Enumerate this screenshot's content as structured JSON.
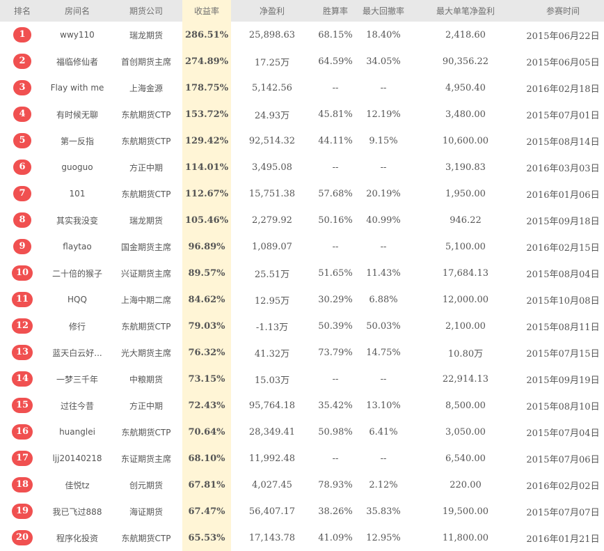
{
  "headers": {
    "rank": "排名",
    "room": "房间名",
    "company": "期货公司",
    "rate": "收益率",
    "net": "净盈利",
    "win": "胜算率",
    "drawdown": "最大回撤率",
    "max_single": "最大单笔净盈利",
    "date": "参赛时间"
  },
  "colors": {
    "badge": "#f05050",
    "highlight_column": "#fff5d6",
    "header_bg": "#e8e8e8"
  },
  "rows": [
    {
      "rank": "1",
      "room": "wwy110",
      "company": "瑞龙期货",
      "rate": "286.51%",
      "net": "25,898.63",
      "win": "68.15%",
      "drawdown": "18.40%",
      "max_single": "2,418.60",
      "date": "2015年06月22日"
    },
    {
      "rank": "2",
      "room": "福临修仙者",
      "company": "首创期货主席",
      "rate": "274.89%",
      "net": "17.25万",
      "win": "64.59%",
      "drawdown": "34.05%",
      "max_single": "90,356.22",
      "date": "2015年06月05日"
    },
    {
      "rank": "3",
      "room": "Flay with me",
      "company": "上海金源",
      "rate": "178.75%",
      "net": "5,142.56",
      "win": "--",
      "drawdown": "--",
      "max_single": "4,950.40",
      "date": "2016年02月18日"
    },
    {
      "rank": "4",
      "room": "有时候无聊",
      "company": "东航期货CTP",
      "rate": "153.72%",
      "net": "24.93万",
      "win": "45.81%",
      "drawdown": "12.19%",
      "max_single": "3,480.00",
      "date": "2015年07月01日"
    },
    {
      "rank": "5",
      "room": "第一反指",
      "company": "东航期货CTP",
      "rate": "129.42%",
      "net": "92,514.32",
      "win": "44.11%",
      "drawdown": "9.15%",
      "max_single": "10,600.00",
      "date": "2015年08月14日"
    },
    {
      "rank": "6",
      "room": "guoguo",
      "company": "方正中期",
      "rate": "114.01%",
      "net": "3,495.08",
      "win": "--",
      "drawdown": "--",
      "max_single": "3,190.83",
      "date": "2016年03月03日"
    },
    {
      "rank": "7",
      "room": "101",
      "company": "东航期货CTP",
      "rate": "112.67%",
      "net": "15,751.38",
      "win": "57.68%",
      "drawdown": "20.19%",
      "max_single": "1,950.00",
      "date": "2016年01月06日"
    },
    {
      "rank": "8",
      "room": "其实我没变",
      "company": "瑞龙期货",
      "rate": "105.46%",
      "net": "2,279.92",
      "win": "50.16%",
      "drawdown": "40.99%",
      "max_single": "946.22",
      "date": "2015年09月18日"
    },
    {
      "rank": "9",
      "room": "flaytao",
      "company": "国金期货主席",
      "rate": "96.89%",
      "net": "1,089.07",
      "win": "--",
      "drawdown": "--",
      "max_single": "5,100.00",
      "date": "2016年02月15日"
    },
    {
      "rank": "10",
      "room": "二十倍的猴子",
      "company": "兴证期货主席",
      "rate": "89.57%",
      "net": "25.51万",
      "win": "51.65%",
      "drawdown": "11.43%",
      "max_single": "17,684.13",
      "date": "2015年08月04日"
    },
    {
      "rank": "11",
      "room": "HQQ",
      "company": "上海中期二席",
      "rate": "84.62%",
      "net": "12.95万",
      "win": "30.29%",
      "drawdown": "6.88%",
      "max_single": "12,000.00",
      "date": "2015年10月08日"
    },
    {
      "rank": "12",
      "room": "修行",
      "company": "东航期货CTP",
      "rate": "79.03%",
      "net": "-1.13万",
      "win": "50.39%",
      "drawdown": "50.03%",
      "max_single": "2,100.00",
      "date": "2015年08月11日"
    },
    {
      "rank": "13",
      "room": "蓝天白云好...",
      "company": "光大期货主席",
      "rate": "76.32%",
      "net": "41.32万",
      "win": "73.79%",
      "drawdown": "14.75%",
      "max_single": "10.80万",
      "date": "2015年07月15日"
    },
    {
      "rank": "14",
      "room": "一梦三千年",
      "company": "中粮期货",
      "rate": "73.15%",
      "net": "15.03万",
      "win": "--",
      "drawdown": "--",
      "max_single": "22,914.13",
      "date": "2015年09月19日"
    },
    {
      "rank": "15",
      "room": "过往今昔",
      "company": "方正中期",
      "rate": "72.43%",
      "net": "95,764.18",
      "win": "35.42%",
      "drawdown": "13.10%",
      "max_single": "8,500.00",
      "date": "2015年08月10日"
    },
    {
      "rank": "16",
      "room": "huanglei",
      "company": "东航期货CTP",
      "rate": "70.64%",
      "net": "28,349.41",
      "win": "50.98%",
      "drawdown": "6.41%",
      "max_single": "3,050.00",
      "date": "2015年07月04日"
    },
    {
      "rank": "17",
      "room": "ljj20140218",
      "company": "东证期货主席",
      "rate": "68.10%",
      "net": "11,992.48",
      "win": "--",
      "drawdown": "--",
      "max_single": "6,540.00",
      "date": "2015年07月06日"
    },
    {
      "rank": "18",
      "room": "佳悦tz",
      "company": "创元期货",
      "rate": "67.81%",
      "net": "4,027.45",
      "win": "78.93%",
      "drawdown": "2.12%",
      "max_single": "220.00",
      "date": "2016年02月02日"
    },
    {
      "rank": "19",
      "room": "我已飞过888",
      "company": "海证期货",
      "rate": "67.47%",
      "net": "56,407.17",
      "win": "38.26%",
      "drawdown": "35.83%",
      "max_single": "19,500.00",
      "date": "2015年07月07日"
    },
    {
      "rank": "20",
      "room": "程序化投资",
      "company": "东航期货CTP",
      "rate": "65.53%",
      "net": "17,143.78",
      "win": "41.09%",
      "drawdown": "12.95%",
      "max_single": "11,800.00",
      "date": "2016年01月21日"
    }
  ]
}
